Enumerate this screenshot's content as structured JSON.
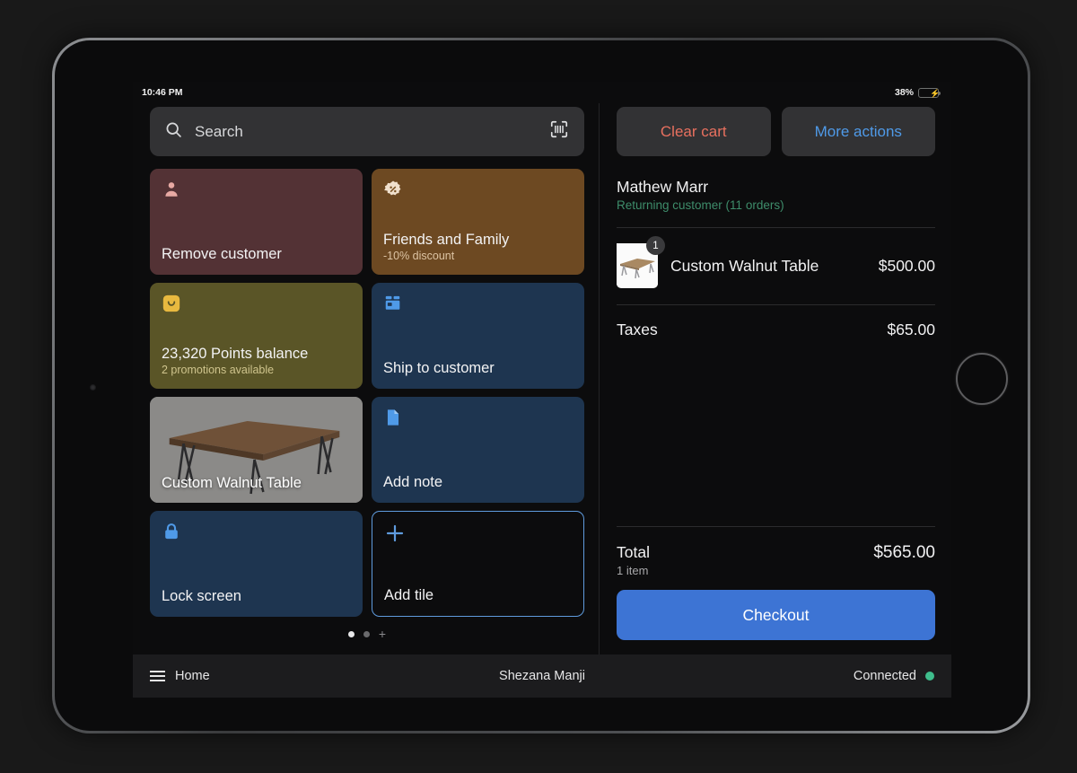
{
  "status_bar": {
    "time": "10:46 PM",
    "battery_percent": "38%",
    "battery_level": 38,
    "charging": true
  },
  "search": {
    "placeholder": "Search",
    "icon": "search-icon",
    "scan_icon": "barcode-scan-icon"
  },
  "tiles": [
    {
      "id": "remove-customer",
      "title": "Remove customer",
      "sub": "",
      "icon": "person-icon",
      "bg": "#533235"
    },
    {
      "id": "friends-and-family",
      "title": "Friends and Family",
      "sub": "-10% discount",
      "icon": "discount-percent-badge-icon",
      "bg": "#6d4922"
    },
    {
      "id": "points-balance",
      "title": "23,320 Points balance",
      "sub": "2 promotions available",
      "icon": "loyalty-points-icon",
      "bg": "#5a5527"
    },
    {
      "id": "ship-to-customer",
      "title": "Ship to customer",
      "sub": "",
      "icon": "shipping-box-icon",
      "bg": "#1e3550"
    },
    {
      "id": "custom-walnut-table",
      "title": "Custom Walnut Table",
      "sub": "",
      "icon": "product-image",
      "bg": "#8b8a88"
    },
    {
      "id": "add-note",
      "title": "Add note",
      "sub": "",
      "icon": "note-document-icon",
      "bg": "#1e3550"
    },
    {
      "id": "lock-screen",
      "title": "Lock screen",
      "sub": "",
      "icon": "lock-icon",
      "bg": "#1e3550"
    },
    {
      "id": "add-tile",
      "title": "Add tile",
      "sub": "",
      "icon": "plus-icon",
      "bg": "#0c0c0d"
    }
  ],
  "pagination": {
    "pages": 2,
    "active": 1,
    "add_label": "+"
  },
  "cart": {
    "clear_label": "Clear cart",
    "more_label": "More actions",
    "customer_name": "Mathew Marr",
    "customer_meta": "Returning customer (11 orders)",
    "line_items": [
      {
        "name": "Custom Walnut Table",
        "price": "$500.00",
        "qty": "1"
      }
    ],
    "taxes_label": "Taxes",
    "taxes_amount": "$65.00",
    "total_label": "Total",
    "total_items": "1 item",
    "total_amount": "$565.00",
    "checkout_label": "Checkout"
  },
  "bottom_bar": {
    "home_label": "Home",
    "menu_icon": "hamburger-menu-icon",
    "staff_name": "Shezana Manji",
    "connection_label": "Connected",
    "connection_color": "#3fbd8c"
  },
  "colors": {
    "accent_blue": "#3d74d4",
    "danger_red": "#e8705f",
    "link_blue": "#4f9ae8",
    "success_green": "#3e8d6b",
    "screen_bg": "#0c0c0d"
  }
}
